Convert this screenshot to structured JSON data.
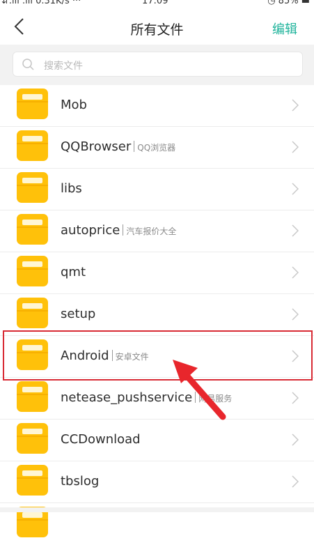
{
  "status_bar": {
    "left": "⇵.ııl .ııl 0.31K/s ···",
    "time": "17:09",
    "right": "◷ 85% ▬"
  },
  "header": {
    "title": "所有文件",
    "edit_label": "编辑"
  },
  "search": {
    "placeholder": "搜索文件"
  },
  "folders": [
    {
      "name": "Mob",
      "desc": ""
    },
    {
      "name": "QQBrowser",
      "desc": "QQ浏览器"
    },
    {
      "name": "libs",
      "desc": ""
    },
    {
      "name": "autoprice",
      "desc": "汽车报价大全"
    },
    {
      "name": "qmt",
      "desc": ""
    },
    {
      "name": "setup",
      "desc": ""
    },
    {
      "name": "Android",
      "desc": "安卓文件"
    },
    {
      "name": "netease_pushservice",
      "desc": "网易服务"
    },
    {
      "name": "CCDownload",
      "desc": ""
    },
    {
      "name": "tbslog",
      "desc": ""
    }
  ],
  "annotation": {
    "highlight_color": "#d82a34",
    "highlighted_folder": "Android"
  },
  "colors": {
    "accent": "#1fb39b",
    "folder": "#ffc10a"
  }
}
